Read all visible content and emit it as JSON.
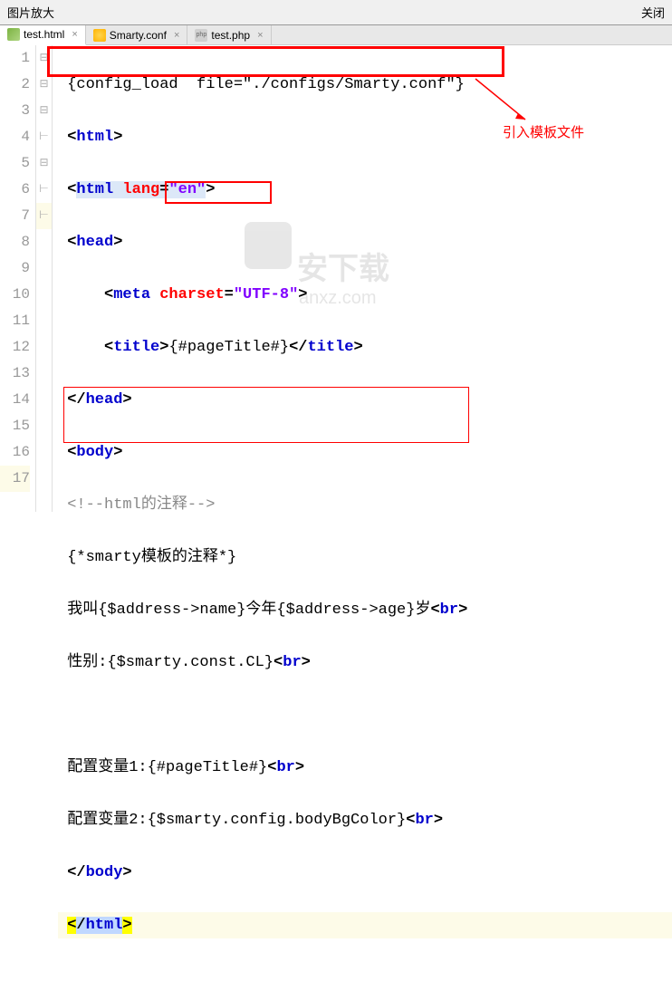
{
  "header": {
    "title": "图片放大",
    "close": "关闭"
  },
  "tabs": [
    {
      "label": "test.html",
      "icon": "html",
      "active": true
    },
    {
      "label": "Smarty.conf",
      "icon": "conf",
      "active": false
    },
    {
      "label": "test.php",
      "icon": "php",
      "active": false
    }
  ],
  "annotation": "引入模板文件",
  "watermark": {
    "brand": "安下载",
    "domain": "anxz.com"
  },
  "lines": [
    "1",
    "2",
    "3",
    "4",
    "5",
    "6",
    "7",
    "8",
    "9",
    "10",
    "11",
    "12",
    "13",
    "14",
    "15",
    "16",
    "17"
  ],
  "folds": [
    "",
    "⊟",
    "⊟",
    "⊟",
    "",
    "",
    "⊢",
    "⊟",
    "",
    "",
    "",
    "",
    "",
    "",
    "",
    "⊢",
    "⊢"
  ],
  "code": {
    "l1_smarty": "{config_load  file=\"./configs/Smarty.conf\"}",
    "l2_tag": "html",
    "l3_tag": "html",
    "l3_attr": "lang",
    "l3_val": "\"en\"",
    "l4_tag": "head",
    "l5_tag": "meta",
    "l5_attr": "charset",
    "l5_val": "\"UTF-8\"",
    "l6_tag": "title",
    "l6_smarty": "{#pageTitle#}",
    "l7_tag": "head",
    "l8_tag": "body",
    "l9_comment": "<!--html的注释-->",
    "l10_txt": "{*smarty模板的注释*}",
    "l11_txt": "我叫{$address->name}今年{$address->age}岁",
    "l11_br": "br",
    "l12_txt": "性别:{$smarty.const.CL}",
    "l12_br": "br",
    "l14_txt": "配置变量1:{#pageTitle#}",
    "l14_br": "br",
    "l15_txt": "配置变量2:{$smarty.config.bodyBgColor}",
    "l15_br": "br",
    "l16_tag": "body",
    "l17_tag": "html"
  }
}
